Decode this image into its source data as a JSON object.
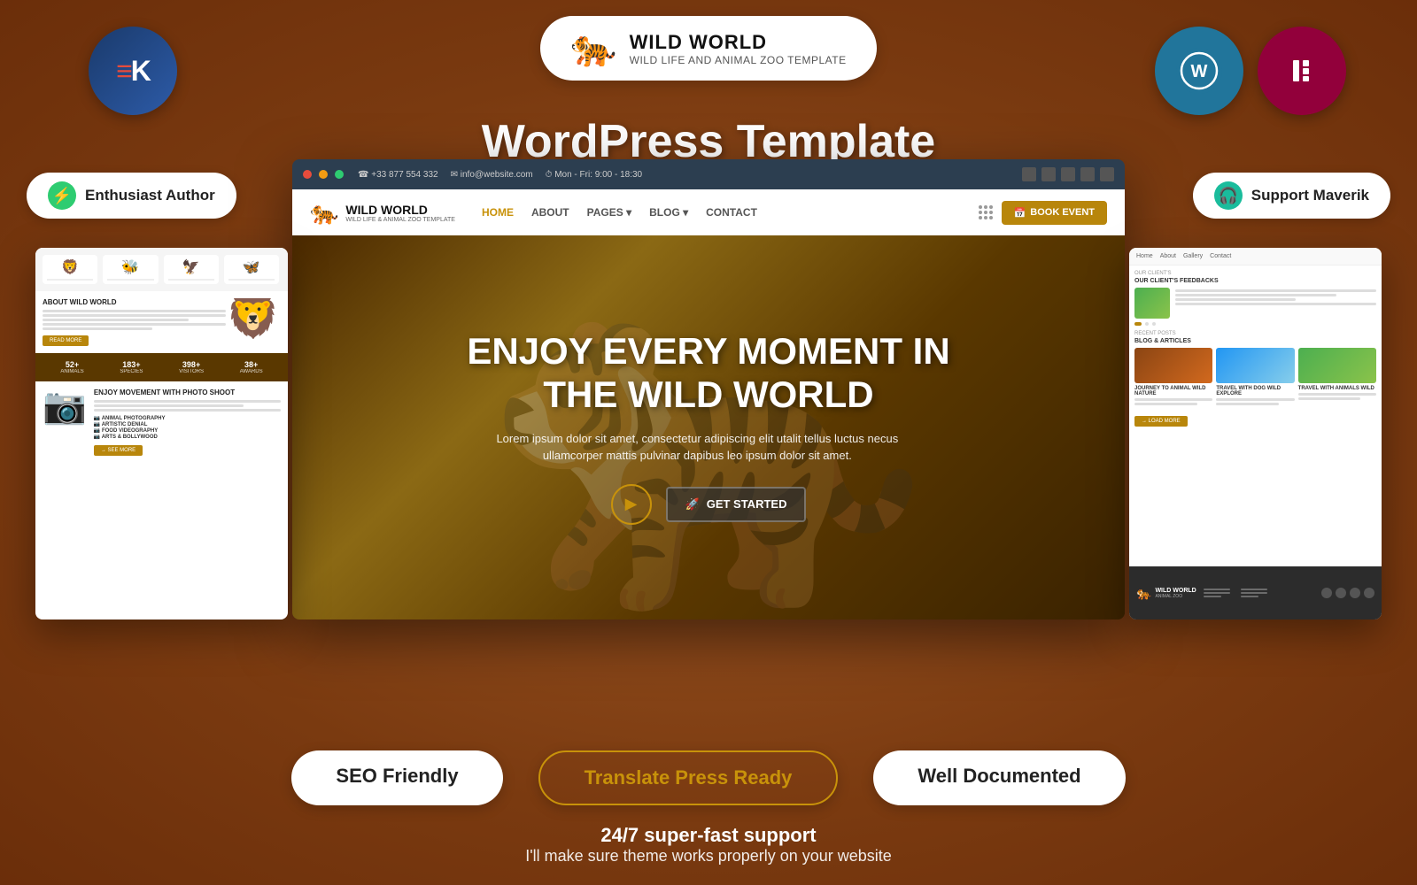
{
  "page": {
    "background_color": "#8B4513"
  },
  "logo_pill": {
    "title": "WILD WORLD",
    "subtitle": "WILD LIFE AND ANIMAL ZOO TEMPLATE",
    "tiger_emoji": "🐅"
  },
  "heading": {
    "text": "WordPress Template"
  },
  "badge_left": {
    "icon": "⚡",
    "label": "Enthusiast Author"
  },
  "badge_right": {
    "icon": "🎧",
    "label": "Support Maverik"
  },
  "browser": {
    "topbar": {
      "phone": "☎ +33 877 554 332",
      "email": "✉ info@website.com",
      "hours": "⏱ Mon - Fri: 9:00 - 18:30"
    },
    "nav": {
      "logo_title": "WILD WORLD",
      "logo_sub": "WILD LIFE & ANIMAL ZOO TEMPLATE",
      "links": [
        "HOME",
        "ABOUT",
        "PAGES ▾",
        "BLOG ▾",
        "CONTACT"
      ],
      "cta": "BOOK EVENT"
    },
    "hero": {
      "title": "ENJOY EVERY MOMENT IN\nTHE WILD WORLD",
      "description": "Lorem ipsum dolor sit amet, consectetur adipiscing elit utalit tellus luctus necus ullamcorper mattis pulvinar dapibus leo ipsum dolor sit amet.",
      "cta_button": "GET STARTED"
    }
  },
  "stats": [
    {
      "number": "52+",
      "label": ""
    },
    {
      "number": "183+",
      "label": ""
    },
    {
      "number": "398+",
      "label": ""
    },
    {
      "number": "38+",
      "label": ""
    }
  ],
  "bottom_pills": {
    "seo": "SEO Friendly",
    "translate": "Translate Press Ready",
    "docs": "Well Documented"
  },
  "support": {
    "title": "24/7 super-fast support",
    "subtitle": "I'll make sure theme works properly on your website"
  }
}
